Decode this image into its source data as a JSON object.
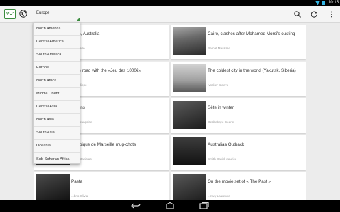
{
  "status": {
    "time": "10:15",
    "wifi_icon": "wifi-icon",
    "battery_icon": "battery-icon",
    "accent": "#33b5e5"
  },
  "app": {
    "logo_text": "VU'",
    "brand_color": "#3b8c3f"
  },
  "region_selector": {
    "selected": "Europe"
  },
  "toolbar": {
    "search_icon": "search-icon",
    "refresh_icon": "refresh-icon",
    "menu_icon": "overflow-menu-icon"
  },
  "dropdown": {
    "options": [
      "North America",
      "Central America",
      "South America",
      "Europe",
      "North Africa",
      "Middle Orient",
      "Central Asia",
      "North Asia",
      "South Asia",
      "Oceania",
      "Sub-Saharan Africa"
    ]
  },
  "cards": [
    {
      "title": "...bin, Australia",
      "author": "...n Claire"
    },
    {
      "title": "Cairo, clashes after Mohamed Morsi's ousting",
      "author": "Bernat Massimo"
    },
    {
      "title": "...the road with the «Jeu des 1000€»",
      "author": "...t Philippe"
    },
    {
      "title": "The coldest city in the world (Yakutsk, Siberia)",
      "author": "Ivncker Steeve"
    },
    {
      "title": "...Nuns",
      "author": "...ier Françoise"
    },
    {
      "title": "Sète in winter",
      "author": "Gesbebaye Cedric"
    },
    {
      "title": "...impique de Marseille mug-chots",
      "author": "...uiz Stanislas"
    },
    {
      "title": "Australian Outback",
      "author": "Smith David Maurice"
    },
    {
      "title": "Pasta",
      "author": "...brio Olivia"
    },
    {
      "title": "On the movie set of « The Past »",
      "author": "...rsvy Laurence"
    }
  ],
  "nav": {
    "back_icon": "back-icon",
    "home_icon": "home-icon",
    "recents_icon": "recents-icon"
  }
}
